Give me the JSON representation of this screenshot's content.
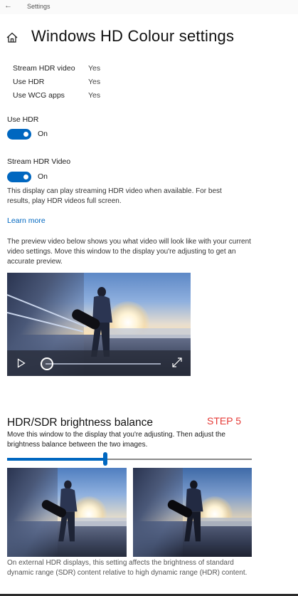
{
  "window": {
    "back_glyph": "←",
    "title": "Settings"
  },
  "page": {
    "title": "Windows HD Colour settings",
    "home_icon": "home-icon"
  },
  "display_info": [
    {
      "key": "Stream HDR video",
      "value": "Yes"
    },
    {
      "key": "Use HDR",
      "value": "Yes"
    },
    {
      "key": "Use WCG apps",
      "value": "Yes"
    }
  ],
  "use_hdr": {
    "label": "Use HDR",
    "state": "On",
    "enabled": true
  },
  "stream_hdr": {
    "label": "Stream HDR Video",
    "state": "On",
    "enabled": true,
    "description": "This display can play streaming HDR video when available. For best results, play HDR videos full screen."
  },
  "learn_more": "Learn more",
  "preview": {
    "description": "The preview video below shows you what video will look like with your current video settings. Move this window to the display you're adjusting to get an accurate preview.",
    "progress": 0.0
  },
  "brightness": {
    "title": "HDR/SDR brightness balance",
    "annotation": "STEP 5",
    "description": "Move this window to the display that you're adjusting. Then adjust the brightness balance between the two images.",
    "value_fraction": 0.4,
    "footer": "On external HDR displays, this setting affects the brightness of standard dynamic range (SDR) content relative to high dynamic range (HDR) content."
  },
  "colors": {
    "accent": "#0067c0",
    "annotation": "#e53935"
  }
}
